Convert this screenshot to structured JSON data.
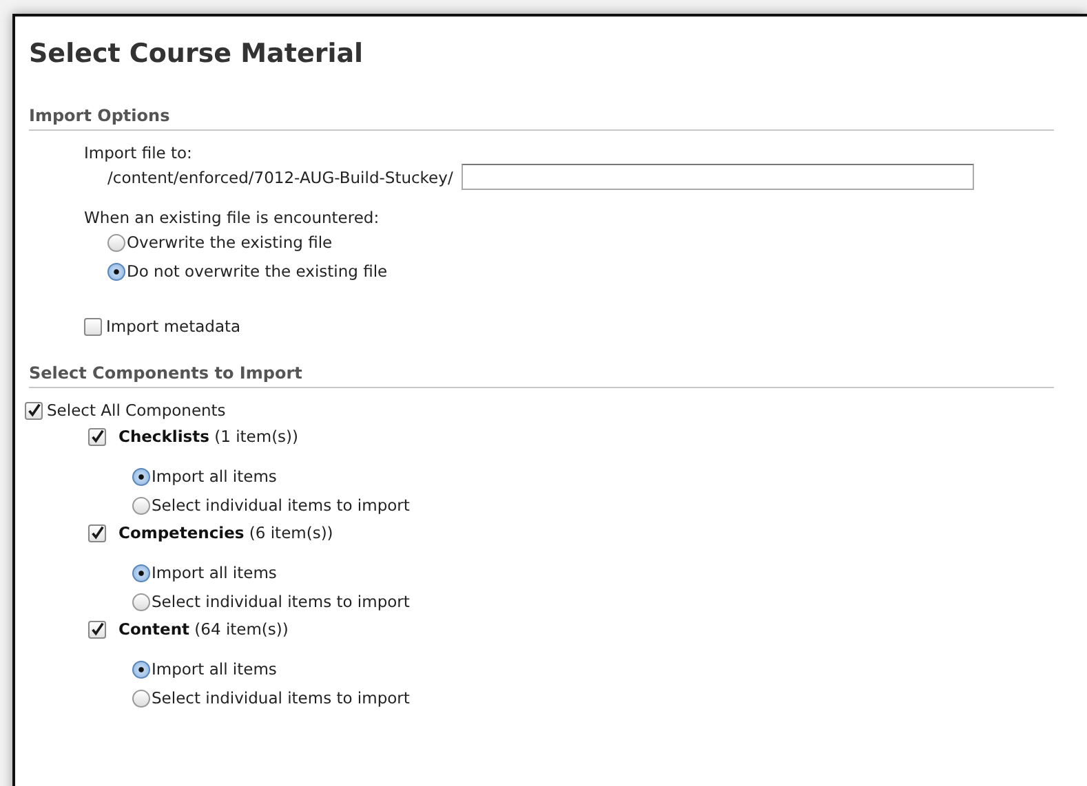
{
  "title": "Select Course Material",
  "import_options": {
    "heading": "Import Options",
    "destination_label": "Import file to:",
    "destination_path": "/content/enforced/7012-AUG-Build-Stuckey/",
    "conflict": {
      "label": "When an existing file is encountered:",
      "options": [
        {
          "label": "Overwrite the existing file",
          "selected": false
        },
        {
          "label": "Do not overwrite the existing file",
          "selected": true
        }
      ]
    },
    "metadata": {
      "label": "Import metadata",
      "checked": false
    }
  },
  "components": {
    "heading": "Select Components to Import",
    "select_all": {
      "label": "Select All Components",
      "checked": true
    },
    "groups": [
      {
        "label": "**Checklists** (1 item(s))",
        "checked": true,
        "options": [
          {
            "label": "Import all items",
            "selected": true
          },
          {
            "label": "Select individual items to import",
            "selected": false
          }
        ]
      },
      {
        "label": "**Competencies** (6 item(s))",
        "checked": true,
        "options": [
          {
            "label": "Import all items",
            "selected": true
          },
          {
            "label": "Select individual items to import",
            "selected": false
          }
        ]
      },
      {
        "label": "**Content** (64 item(s))",
        "checked": true,
        "options": [
          {
            "label": "Import all items",
            "selected": true
          },
          {
            "label": "Select individual items to import",
            "selected": false
          }
        ]
      }
    ]
  }
}
